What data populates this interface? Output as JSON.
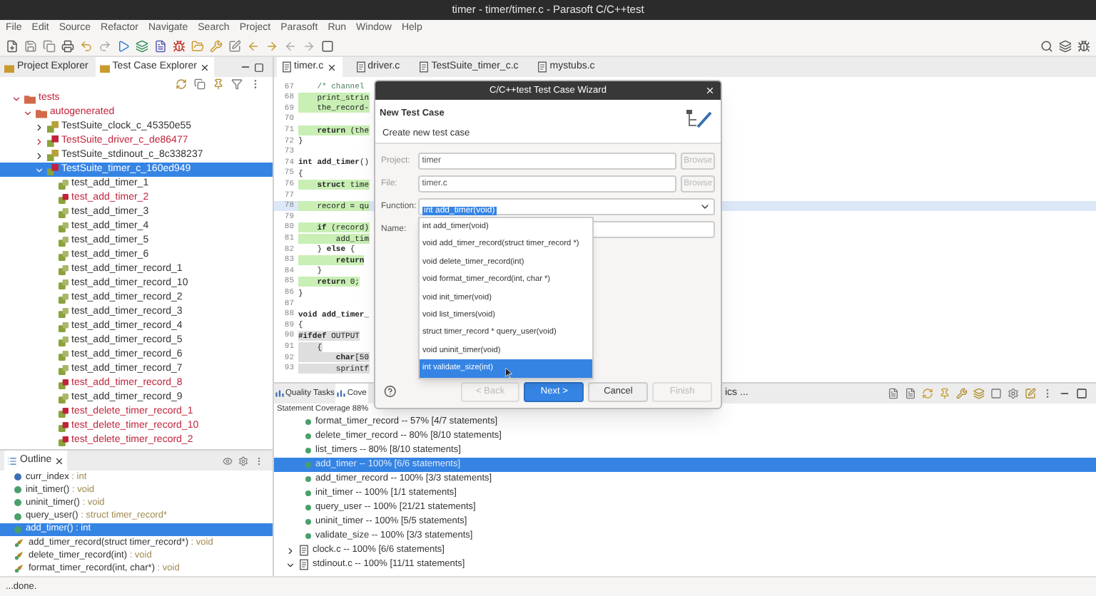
{
  "window": {
    "title": "timer - timer/timer.c - Parasoft C/C++test"
  },
  "menu": [
    "File",
    "Edit",
    "Source",
    "Refactor",
    "Navigate",
    "Search",
    "Project",
    "Parasoft",
    "Run",
    "Window",
    "Help"
  ],
  "explorer": {
    "tabs": [
      {
        "label": "Project Explorer",
        "selected": false
      },
      {
        "label": "Test Case Explorer",
        "selected": true
      }
    ],
    "tree": [
      {
        "label": "tests",
        "kind": "folder",
        "failed": true,
        "selected": false,
        "expanded": true,
        "children": [
          {
            "label": "autogenerated",
            "kind": "folder",
            "failed": true,
            "selected": false,
            "expanded": true,
            "children": [
              {
                "label": "TestSuite_clock_c_45350e55",
                "kind": "suite",
                "failed": false,
                "selected": false,
                "expanded": false
              },
              {
                "label": "TestSuite_driver_c_de86477",
                "kind": "suite",
                "failed": true,
                "selected": false,
                "expanded": false
              },
              {
                "label": "TestSuite_stdinout_c_8c338237",
                "kind": "suite",
                "failed": false,
                "selected": false,
                "expanded": false
              },
              {
                "label": "TestSuite_timer_c_160ed949",
                "kind": "suite",
                "failed": true,
                "selected": true,
                "expanded": true,
                "children": [
                  {
                    "label": "test_add_timer_1",
                    "kind": "test",
                    "failed": false,
                    "selected": false
                  },
                  {
                    "label": "test_add_timer_2",
                    "kind": "test",
                    "failed": true,
                    "selected": false
                  },
                  {
                    "label": "test_add_timer_3",
                    "kind": "test",
                    "failed": false,
                    "selected": false
                  },
                  {
                    "label": "test_add_timer_4",
                    "kind": "test",
                    "failed": false,
                    "selected": false
                  },
                  {
                    "label": "test_add_timer_5",
                    "kind": "test",
                    "failed": false,
                    "selected": false
                  },
                  {
                    "label": "test_add_timer_6",
                    "kind": "test",
                    "failed": false,
                    "selected": false
                  },
                  {
                    "label": "test_add_timer_record_1",
                    "kind": "test",
                    "failed": false,
                    "selected": false
                  },
                  {
                    "label": "test_add_timer_record_10",
                    "kind": "test",
                    "failed": false,
                    "selected": false
                  },
                  {
                    "label": "test_add_timer_record_2",
                    "kind": "test",
                    "failed": false,
                    "selected": false
                  },
                  {
                    "label": "test_add_timer_record_3",
                    "kind": "test",
                    "failed": false,
                    "selected": false
                  },
                  {
                    "label": "test_add_timer_record_4",
                    "kind": "test",
                    "failed": false,
                    "selected": false
                  },
                  {
                    "label": "test_add_timer_record_5",
                    "kind": "test",
                    "failed": false,
                    "selected": false
                  },
                  {
                    "label": "test_add_timer_record_6",
                    "kind": "test",
                    "failed": false,
                    "selected": false
                  },
                  {
                    "label": "test_add_timer_record_7",
                    "kind": "test",
                    "failed": false,
                    "selected": false
                  },
                  {
                    "label": "test_add_timer_record_8",
                    "kind": "test",
                    "failed": true,
                    "selected": false
                  },
                  {
                    "label": "test_add_timer_record_9",
                    "kind": "test",
                    "failed": false,
                    "selected": false
                  },
                  {
                    "label": "test_delete_timer_record_1",
                    "kind": "test",
                    "failed": true,
                    "selected": false
                  },
                  {
                    "label": "test_delete_timer_record_10",
                    "kind": "test",
                    "failed": true,
                    "selected": false
                  },
                  {
                    "label": "test_delete_timer_record_2",
                    "kind": "test",
                    "failed": true,
                    "selected": false
                  }
                ]
              }
            ]
          }
        ]
      }
    ]
  },
  "outline": {
    "title": "Outline",
    "items": [
      {
        "name": "curr_index",
        "type": " : int",
        "kind": "variable",
        "selected": false
      },
      {
        "name": "init_timer()",
        "type": " : void",
        "kind": "function",
        "selected": false
      },
      {
        "name": "uninit_timer()",
        "type": " : void",
        "kind": "function",
        "selected": false
      },
      {
        "name": "query_user()",
        "type": " : struct timer_record*",
        "kind": "function",
        "selected": false
      },
      {
        "name": "add_timer()",
        "type": " : int",
        "kind": "function",
        "selected": true
      },
      {
        "name": "add_timer_record(struct timer_record*)",
        "type": " : void",
        "kind": "declaration",
        "selected": false
      },
      {
        "name": "delete_timer_record(int)",
        "type": " : void",
        "kind": "declaration",
        "selected": false
      },
      {
        "name": "format_timer_record(int, char*)",
        "type": " : void",
        "kind": "declaration",
        "selected": false
      }
    ]
  },
  "editor": {
    "tabs": [
      {
        "label": "timer.c",
        "selected": true
      },
      {
        "label": "driver.c",
        "selected": false
      },
      {
        "label": "TestSuite_timer_c.c",
        "selected": false
      },
      {
        "label": "mystubs.c",
        "selected": false
      }
    ],
    "lines": [
      {
        "number": "67",
        "text": "    /* channel",
        "kind": "comment",
        "current": false
      },
      {
        "number": "68",
        "text": "    print_strin",
        "kind": "covered",
        "current": false
      },
      {
        "number": "69",
        "text": "    the_record-",
        "kind": "covered",
        "current": false
      },
      {
        "number": "70",
        "current": false
      },
      {
        "number": "71",
        "text": "    **return** (the",
        "kind": "covered",
        "current": false
      },
      {
        "number": "72",
        "text": "}",
        "kind": "plain",
        "current": false
      },
      {
        "number": "73",
        "current": false
      },
      {
        "number": "74",
        "text": "**int** **add_timer**()",
        "kind": "plain",
        "current": false
      },
      {
        "number": "75",
        "text": "{",
        "kind": "plain",
        "current": false
      },
      {
        "number": "76",
        "text": "    **struct** time",
        "kind": "covered",
        "current": false
      },
      {
        "number": "77",
        "current": false
      },
      {
        "number": "78",
        "text": "    record = qu",
        "kind": "covered",
        "current": true
      },
      {
        "number": "79",
        "current": false
      },
      {
        "number": "80",
        "text": "    **if** (record)",
        "kind": "covered",
        "current": false
      },
      {
        "number": "81",
        "text": "        add_tim",
        "kind": "covered",
        "current": false
      },
      {
        "number": "82",
        "text": "    } **else** {",
        "kind": "plain",
        "current": false
      },
      {
        "number": "83",
        "text": "        **return**",
        "kind": "covered",
        "current": false
      },
      {
        "number": "84",
        "text": "    }",
        "kind": "plain",
        "current": false
      },
      {
        "number": "85",
        "text": "    **return** 0;",
        "kind": "covered",
        "current": false
      },
      {
        "number": "86",
        "text": "}",
        "kind": "plain",
        "current": false
      },
      {
        "number": "87",
        "current": false
      },
      {
        "number": "88",
        "text": "**void** **add_timer_**",
        "kind": "plain",
        "current": false
      },
      {
        "number": "89",
        "text": "{",
        "kind": "plain",
        "current": false
      },
      {
        "number": "90",
        "text": "**#ifdef** OUTPUT",
        "kind": "excluded",
        "current": false
      },
      {
        "number": "91",
        "text": "    {",
        "kind": "excluded",
        "current": false
      },
      {
        "number": "92",
        "text": "        **char**[50",
        "kind": "excluded",
        "current": false
      },
      {
        "number": "93",
        "text": "        sprintf",
        "kind": "excluded",
        "current": false
      }
    ]
  },
  "bottom": {
    "tabs": [
      {
        "label": "Quality Tasks",
        "selected": false
      },
      {
        "label": "Cove",
        "selected": true
      }
    ],
    "hidden_tab_tail": "ics ...",
    "summary": "Statement Coverage 88%",
    "items": [
      {
        "label": "format_timer_record -- 57% [4/7 statements]",
        "kind": "function",
        "selected": false
      },
      {
        "label": "delete_timer_record -- 80% [8/10 statements]",
        "kind": "function",
        "selected": false
      },
      {
        "label": "list_timers -- 80% [8/10 statements]",
        "kind": "function",
        "selected": false
      },
      {
        "label": "add_timer -- 100% [6/6 statements]",
        "kind": "function",
        "selected": true
      },
      {
        "label": "add_timer_record -- 100% [3/3 statements]",
        "kind": "function",
        "selected": false
      },
      {
        "label": "init_timer -- 100% [1/1 statements]",
        "kind": "function",
        "selected": false
      },
      {
        "label": "query_user -- 100% [21/21 statements]",
        "kind": "function",
        "selected": false
      },
      {
        "label": "uninit_timer -- 100% [5/5 statements]",
        "kind": "function",
        "selected": false
      },
      {
        "label": "validate_size -- 100% [3/3 statements]",
        "kind": "function",
        "selected": false
      },
      {
        "label": "clock.c -- 100% [6/6 statements]",
        "kind": "file",
        "selected": false,
        "expanded": false
      },
      {
        "label": "stdinout.c -- 100% [11/11 statements]",
        "kind": "file",
        "selected": false,
        "expanded": true
      }
    ]
  },
  "dialog": {
    "title": "C/C++test Test Case Wizard",
    "heading": "New Test Case",
    "description": "Create new test case",
    "fields": [
      {
        "label": "Project:",
        "value": "timer",
        "button": "Browse",
        "disabled": true
      },
      {
        "label": "File:",
        "value": "timer.c",
        "button": "Browse",
        "disabled": true
      }
    ],
    "function": {
      "label": "Function:",
      "value": "int add_timer(void)",
      "options": [
        {
          "label": "int add_timer(void)",
          "highlighted": false
        },
        {
          "label": "void add_timer_record(struct timer_record *)",
          "highlighted": false
        },
        {
          "label": "void delete_timer_record(int)",
          "highlighted": false
        },
        {
          "label": "void format_timer_record(int, char *)",
          "highlighted": false
        },
        {
          "label": "void init_timer(void)",
          "highlighted": false
        },
        {
          "label": "void list_timers(void)",
          "highlighted": false
        },
        {
          "label": "struct timer_record * query_user(void)",
          "highlighted": false
        },
        {
          "label": "void uninit_timer(void)",
          "highlighted": false
        },
        {
          "label": "int validate_size(int)",
          "highlighted": true
        }
      ]
    },
    "name": {
      "label": "Name:"
    },
    "buttons": [
      {
        "label": "< Back",
        "disabled": true,
        "primary": false
      },
      {
        "label": "Next >",
        "disabled": false,
        "primary": true
      },
      {
        "label": "Cancel",
        "disabled": false,
        "primary": false
      },
      {
        "label": "Finish",
        "disabled": true,
        "primary": false
      }
    ]
  },
  "status_bar": "...done."
}
